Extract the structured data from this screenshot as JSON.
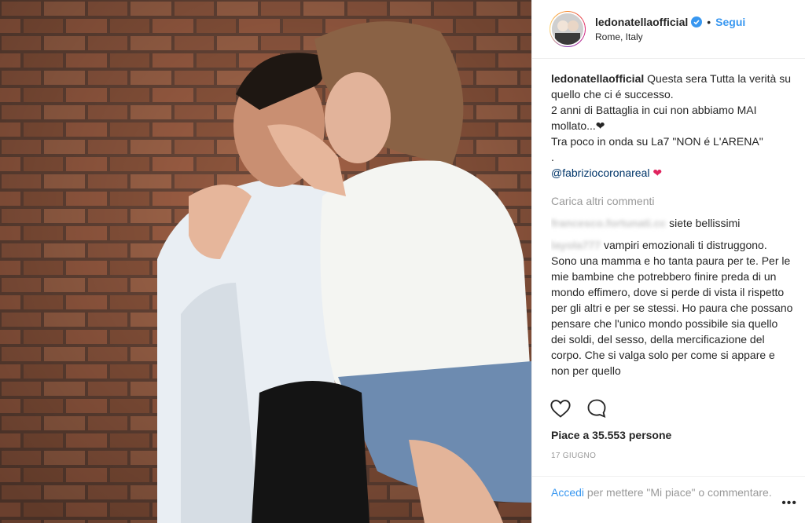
{
  "header": {
    "username": "ledonatellaofficial",
    "separator": "•",
    "follow_label": "Segui",
    "location": "Rome, Italy"
  },
  "caption": {
    "username": "ledonatellaofficial",
    "line1": "Questa sera Tutta la verità su quello che ci é successo.",
    "line2": "2 anni di Battaglia in cui non abbiamo MAI mollato...❤",
    "line3": "Tra poco in onda su La7 \"NON é L'ARENA\"",
    "line4": ".",
    "mention": "@fabriziocoronareal",
    "emoji": "❤"
  },
  "load_more": "Carica altri commenti",
  "comments": [
    {
      "username": "francesco.fortunati.cc",
      "text": "siete bellissimi"
    },
    {
      "username": "layola777",
      "text": "vampiri emozionali ti distruggono. Sono una mamma e ho tanta paura per te. Per le mie bambine che potrebbero finire preda di un mondo effimero, dove si perde di vista il rispetto per gli altri e per se stessi. Ho paura che possano pensare che l'unico mondo possibile sia quello dei soldi, del sesso, della mercificazione del corpo. Che si valga solo per come si appare e non per quello"
    }
  ],
  "likes_text": "Piace a 35.553 persone",
  "date": "17 GIUGNO",
  "login": {
    "link": "Accedi",
    "rest": "per mettere \"Mi piace\" o commentare."
  },
  "more_options": "•••",
  "icons": {
    "like": "heart-icon",
    "comment": "comment-icon",
    "verified": "verified-badge-icon"
  },
  "colors": {
    "link": "#3897f0",
    "mention": "#003569",
    "muted": "#999999",
    "text": "#262626"
  }
}
